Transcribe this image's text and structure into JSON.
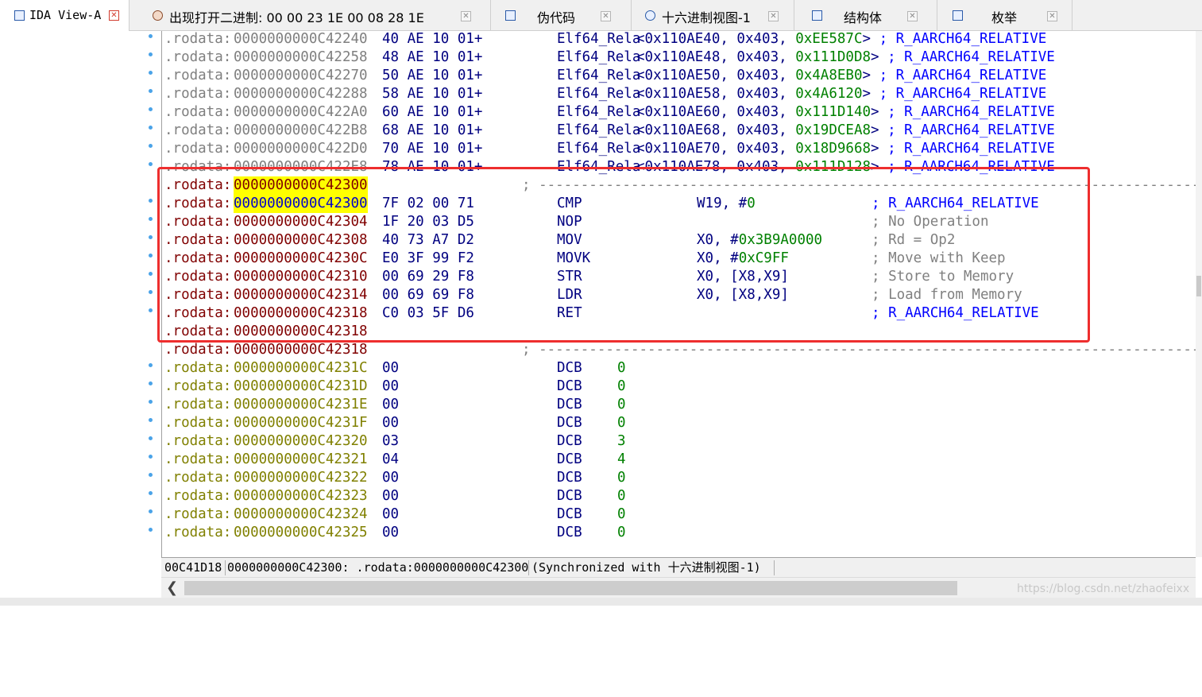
{
  "tabs": [
    {
      "label": "IDA View-A",
      "active": true,
      "icon": "ida-view-icon"
    },
    {
      "label": "出现打开二进制: 00 00 23 1E 00 08 28 1E",
      "active": false,
      "icon": "search-result-icon"
    },
    {
      "label": "伪代码",
      "active": false,
      "icon": "pseudocode-icon"
    },
    {
      "label": "十六进制视图-1",
      "active": false,
      "icon": "hex-view-icon"
    },
    {
      "label": "结构体",
      "active": false,
      "icon": "structures-icon"
    },
    {
      "label": "枚举",
      "active": false,
      "icon": "enums-icon"
    }
  ],
  "close_glyph": "✕",
  "lines": [
    {
      "seg": ".rodata:",
      "addr": "0000000000C42240",
      "bytes": "40 AE 10 01+",
      "mnem": "Elf64_Rela",
      "op_pre": "<0x110AE40, 0x403, ",
      "op_num": "0xEE587C",
      "op_post": "> ",
      "cmt": "; R_AARCH64_RELATIVE"
    },
    {
      "seg": ".rodata:",
      "addr": "0000000000C42258",
      "bytes": "48 AE 10 01+",
      "mnem": "Elf64_Rela",
      "op_pre": "<0x110AE48, 0x403, ",
      "op_num": "0x111D0D8",
      "op_post": "> ",
      "cmt": "; R_AARCH64_RELATIVE"
    },
    {
      "seg": ".rodata:",
      "addr": "0000000000C42270",
      "bytes": "50 AE 10 01+",
      "mnem": "Elf64_Rela",
      "op_pre": "<0x110AE50, 0x403, ",
      "op_num": "0x4A8EB0",
      "op_post": "> ",
      "cmt": "; R_AARCH64_RELATIVE"
    },
    {
      "seg": ".rodata:",
      "addr": "0000000000C42288",
      "bytes": "58 AE 10 01+",
      "mnem": "Elf64_Rela",
      "op_pre": "<0x110AE58, 0x403, ",
      "op_num": "0x4A6120",
      "op_post": "> ",
      "cmt": "; R_AARCH64_RELATIVE"
    },
    {
      "seg": ".rodata:",
      "addr": "0000000000C422A0",
      "bytes": "60 AE 10 01+",
      "mnem": "Elf64_Rela",
      "op_pre": "<0x110AE60, 0x403, ",
      "op_num": "0x111D140",
      "op_post": "> ",
      "cmt": "; R_AARCH64_RELATIVE"
    },
    {
      "seg": ".rodata:",
      "addr": "0000000000C422B8",
      "bytes": "68 AE 10 01+",
      "mnem": "Elf64_Rela",
      "op_pre": "<0x110AE68, 0x403, ",
      "op_num": "0x19DCEA8",
      "op_post": "> ",
      "cmt": "; R_AARCH64_RELATIVE"
    },
    {
      "seg": ".rodata:",
      "addr": "0000000000C422D0",
      "bytes": "70 AE 10 01+",
      "mnem": "Elf64_Rela",
      "op_pre": "<0x110AE70, 0x403, ",
      "op_num": "0x18D9668",
      "op_post": "> ",
      "cmt": "; R_AARCH64_RELATIVE"
    },
    {
      "seg": ".rodata:",
      "addr": "0000000000C422E8",
      "bytes": "78 AE 10 01+",
      "mnem": "Elf64_Rela",
      "op_pre": "<0x110AE78, 0x403, ",
      "op_num": "0x111D128",
      "op_post": "> ",
      "cmt": "; R_AARCH64_RELATIVE"
    },
    {
      "seg": ".rodata:",
      "addr": "0000000000C42300",
      "sep": "; ---------------------------------------------------------------------------------"
    },
    {
      "seg": ".rodata:",
      "addr": "0000000000C42300",
      "bytes": "7F 02 00 71",
      "mnem": "CMP",
      "op_pre": "W19, #",
      "op_num": "0",
      "cmt": "; R_AARCH64_RELATIVE"
    },
    {
      "seg": ".rodata:",
      "addr": "0000000000C42304",
      "bytes": "1F 20 03 D5",
      "mnem": "NOP",
      "cmt": "; No Operation"
    },
    {
      "seg": ".rodata:",
      "addr": "0000000000C42308",
      "bytes": "40 73 A7 D2",
      "mnem": "MOV",
      "op_pre": "X0, #",
      "op_num": "0x3B9A0000",
      "cmt": "; Rd = Op2"
    },
    {
      "seg": ".rodata:",
      "addr": "0000000000C4230C",
      "bytes": "E0 3F 99 F2",
      "mnem": "MOVK",
      "op_pre": "X0, #",
      "op_num": "0xC9FF",
      "cmt": "; Move with Keep"
    },
    {
      "seg": ".rodata:",
      "addr": "0000000000C42310",
      "bytes": "00 69 29 F8",
      "mnem": "STR",
      "op_pre": "X0, [X8,X9]",
      "cmt": "; Store to Memory"
    },
    {
      "seg": ".rodata:",
      "addr": "0000000000C42314",
      "bytes": "00 69 69 F8",
      "mnem": "LDR",
      "op_pre": "X0, [X8,X9]",
      "cmt": "; Load from Memory"
    },
    {
      "seg": ".rodata:",
      "addr": "0000000000C42318",
      "bytes": "C0 03 5F D6",
      "mnem": "RET",
      "cmt": "; R_AARCH64_RELATIVE"
    },
    {
      "seg": ".rodata:",
      "addr": "0000000000C42318"
    },
    {
      "seg": ".rodata:",
      "addr": "0000000000C42318",
      "sep": "; ---------------------------------------------------------------------------------"
    },
    {
      "seg": ".rodata:",
      "addr": "0000000000C4231C",
      "bytes": "00",
      "mnem": "DCB",
      "op_num": "0"
    },
    {
      "seg": ".rodata:",
      "addr": "0000000000C4231D",
      "bytes": "00",
      "mnem": "DCB",
      "op_num": "0"
    },
    {
      "seg": ".rodata:",
      "addr": "0000000000C4231E",
      "bytes": "00",
      "mnem": "DCB",
      "op_num": "0"
    },
    {
      "seg": ".rodata:",
      "addr": "0000000000C4231F",
      "bytes": "00",
      "mnem": "DCB",
      "op_num": "0"
    },
    {
      "seg": ".rodata:",
      "addr": "0000000000C42320",
      "bytes": "03",
      "mnem": "DCB",
      "op_num": "3"
    },
    {
      "seg": ".rodata:",
      "addr": "0000000000C42321",
      "bytes": "04",
      "mnem": "DCB",
      "op_num": "4"
    },
    {
      "seg": ".rodata:",
      "addr": "0000000000C42322",
      "bytes": "00",
      "mnem": "DCB",
      "op_num": "0"
    },
    {
      "seg": ".rodata:",
      "addr": "0000000000C42323",
      "bytes": "00",
      "mnem": "DCB",
      "op_num": "0"
    },
    {
      "seg": ".rodata:",
      "addr": "0000000000C42324",
      "bytes": "00",
      "mnem": "DCB",
      "op_num": "0"
    },
    {
      "seg": ".rodata:",
      "addr": "0000000000C42325",
      "bytes": "00",
      "mnem": "DCB",
      "op_num": "0"
    }
  ],
  "status": {
    "offset": "00C41D18",
    "location": "0000000000C42300: .rodata:0000000000C42300",
    "sync": "(Synchronized with 十六进制视图-1)"
  },
  "scroll_arrow_left": "❮",
  "watermark": "https://blog.csdn.net/zhaofeixx",
  "colors": {
    "segment_gray": "#7f7f7f",
    "segment_code": "#800000",
    "segment_data": "#808000",
    "instruction": "#000080",
    "number": "#008000",
    "comment": "#808080",
    "highlight": "#ffff00",
    "annotation_box": "#ee2e2e"
  }
}
